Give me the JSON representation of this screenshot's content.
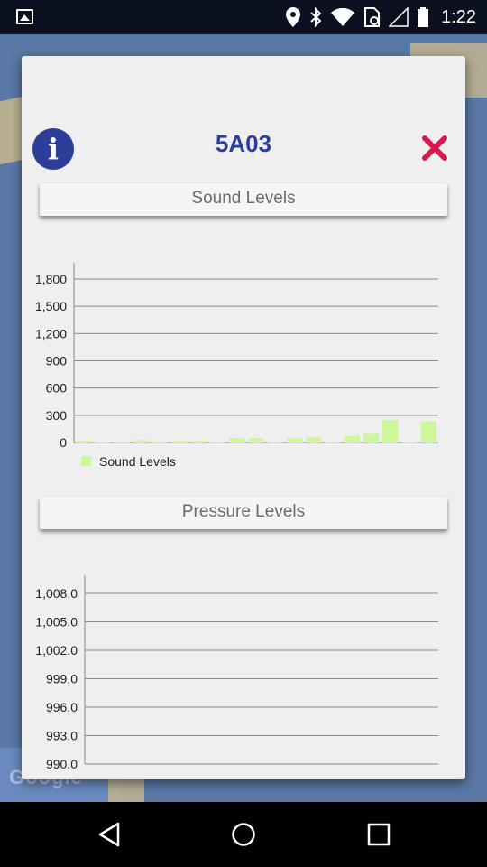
{
  "status_bar": {
    "time": "1:22",
    "icons": [
      "gallery-icon",
      "location-icon",
      "bluetooth-icon",
      "wifi-icon",
      "nfc-sim-icon",
      "signal-icon",
      "battery-icon"
    ]
  },
  "map": {
    "watermark": "Google"
  },
  "dialog": {
    "title": "5A03",
    "info_icon": "info-icon",
    "close_icon": "close-icon",
    "colors": {
      "accent": "#2c3e99",
      "close": "#d81b4f",
      "bar": "#ccf79a"
    }
  },
  "sections": {
    "sound_label": "Sound Levels",
    "pressure_label": "Pressure Levels"
  },
  "chart_data": [
    {
      "type": "bar",
      "title": "",
      "ylim": [
        0,
        1800
      ],
      "yticks": [
        0,
        300,
        600,
        900,
        1200,
        1500,
        1800
      ],
      "ytick_labels": [
        "0",
        "300",
        "600",
        "900",
        "1,200",
        "1,500",
        "1,800"
      ],
      "grid": true,
      "legend": "bottom-left",
      "series": [
        {
          "name": "Sound Levels",
          "values": [
            20,
            8,
            10,
            25,
            12,
            18,
            20,
            8,
            50,
            50,
            10,
            48,
            55,
            10,
            75,
            95,
            250,
            8,
            235
          ]
        }
      ]
    },
    {
      "type": "bar",
      "title": "",
      "ylim": [
        990.0,
        1008.0
      ],
      "yticks": [
        990.0,
        993.0,
        996.0,
        999.0,
        1002.0,
        1005.0,
        1008.0
      ],
      "ytick_labels": [
        "990.0",
        "993.0",
        "996.0",
        "999.0",
        "1,002.0",
        "1,005.0",
        "1,008.0"
      ],
      "grid": true,
      "series": []
    }
  ]
}
